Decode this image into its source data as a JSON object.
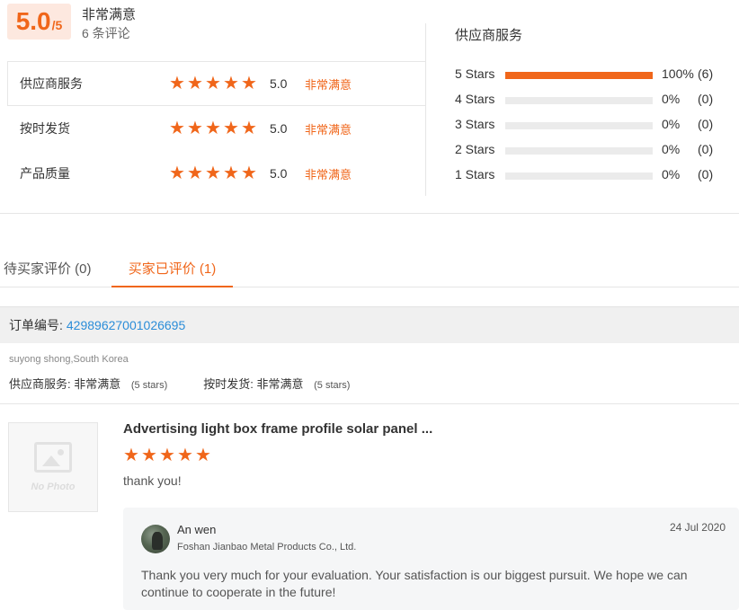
{
  "summary": {
    "score": "5.0",
    "score_suffix": "/5",
    "overall_label": "非常满意",
    "review_count": "6 条评论"
  },
  "ratings": [
    {
      "label": "供应商服务",
      "stars": 5,
      "score": "5.0",
      "text": "非常满意"
    },
    {
      "label": "按时发货",
      "stars": 5,
      "score": "5.0",
      "text": "非常满意"
    },
    {
      "label": "产品质量",
      "stars": 5,
      "score": "5.0",
      "text": "非常满意"
    }
  ],
  "distribution": {
    "title": "供应商服务",
    "rows": [
      {
        "label": "5  Stars",
        "fraction": 1.0,
        "pct": "100%",
        "count": "(6)"
      },
      {
        "label": "4  Stars",
        "fraction": 0.0,
        "pct": "0%",
        "count": "(0)"
      },
      {
        "label": "3  Stars",
        "fraction": 0.0,
        "pct": "0%",
        "count": "(0)"
      },
      {
        "label": "2  Stars",
        "fraction": 0.0,
        "pct": "0%",
        "count": "(0)"
      },
      {
        "label": "1  Stars",
        "fraction": 0.0,
        "pct": "0%",
        "count": "(0)"
      }
    ]
  },
  "tabs": {
    "pending": "待买家评价 (0)",
    "done": "买家已评价 (1)"
  },
  "order": {
    "label": "订单编号:",
    "number": "42989627001026695"
  },
  "buyer": {
    "name": "suyong shong,South Korea",
    "supplier_service_label": "供应商服务:",
    "supplier_service_value": "非常满意",
    "supplier_service_stars": "(5 stars)",
    "ontime_label": "按时发货:",
    "ontime_value": "非常满意",
    "ontime_stars": "(5 stars)"
  },
  "review": {
    "no_photo_text": "No Photo",
    "product_title": "Advertising light box frame profile solar panel ...",
    "stars": 5,
    "text": "thank you!"
  },
  "reply": {
    "name": "An wen",
    "company": "Foshan Jianbao Metal Products Co., Ltd.",
    "date": "24 Jul 2020",
    "text": "Thank you very much for your evaluation. Your satisfaction is our biggest pursuit. We hope we can continue to cooperate in the future!"
  },
  "colors": {
    "accent": "#f0661a",
    "link": "#2b8dd8"
  },
  "icons": {
    "star": "star-icon",
    "avatar": "avatar",
    "no_photo": "image-placeholder-icon"
  }
}
